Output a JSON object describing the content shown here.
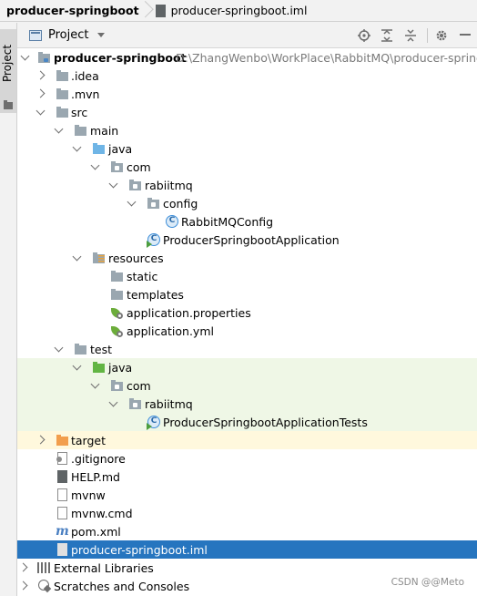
{
  "breadcrumb": {
    "root": "producer-springboot",
    "file": "producer-springboot.iml"
  },
  "stripe": {
    "label": "Project"
  },
  "tool_window": {
    "title": "Project",
    "buttons": [
      "locate-icon",
      "expand-all-icon",
      "collapse-all-icon",
      "gear-icon",
      "minimize-icon"
    ]
  },
  "tree": [
    {
      "name": "producer-springboot",
      "path": "D:\\ZhangWenbo\\WorkPlace\\RabbitMQ\\producer-springb",
      "icon": "module-folder-icon",
      "expanded": true
    },
    {
      "name": ".idea",
      "icon": "folder-icon",
      "expanded": false
    },
    {
      "name": ".mvn",
      "icon": "folder-icon",
      "expanded": false
    },
    {
      "name": "src",
      "icon": "folder-icon",
      "expanded": true
    },
    {
      "name": "main",
      "icon": "folder-icon",
      "expanded": true
    },
    {
      "name": "java",
      "icon": "source-root-folder-icon",
      "expanded": true
    },
    {
      "name": "com",
      "icon": "package-icon",
      "expanded": true
    },
    {
      "name": "rabiitmq",
      "icon": "package-icon",
      "expanded": true
    },
    {
      "name": "config",
      "icon": "package-icon",
      "expanded": true
    },
    {
      "name": "RabbitMQConfig",
      "icon": "class-icon"
    },
    {
      "name": "ProducerSpringbootApplication",
      "icon": "runnable-class-icon"
    },
    {
      "name": "resources",
      "icon": "resources-folder-icon",
      "expanded": true
    },
    {
      "name": "static",
      "icon": "folder-icon"
    },
    {
      "name": "templates",
      "icon": "folder-icon"
    },
    {
      "name": "application.properties",
      "icon": "spring-config-icon"
    },
    {
      "name": "application.yml",
      "icon": "spring-config-icon"
    },
    {
      "name": "test",
      "icon": "folder-icon",
      "expanded": true
    },
    {
      "name": "java",
      "icon": "test-root-folder-icon",
      "expanded": true
    },
    {
      "name": "com",
      "icon": "package-icon",
      "expanded": true
    },
    {
      "name": "rabiitmq",
      "icon": "package-icon",
      "expanded": true
    },
    {
      "name": "ProducerSpringbootApplicationTests",
      "icon": "runnable-class-icon"
    },
    {
      "name": "target",
      "icon": "excluded-folder-icon",
      "expanded": false
    },
    {
      "name": ".gitignore",
      "icon": "gitignore-file-icon"
    },
    {
      "name": "HELP.md",
      "icon": "markdown-file-icon"
    },
    {
      "name": "mvnw",
      "icon": "file-icon"
    },
    {
      "name": "mvnw.cmd",
      "icon": "file-icon"
    },
    {
      "name": "pom.xml",
      "icon": "maven-icon"
    },
    {
      "name": "producer-springboot.iml",
      "icon": "iml-file-icon",
      "selected": true
    },
    {
      "name": "External Libraries",
      "icon": "libraries-icon",
      "expanded": false
    },
    {
      "name": "Scratches and Consoles",
      "icon": "scratches-icon",
      "expanded": false
    }
  ],
  "watermark": "CSDN @@Meto",
  "colors": {
    "selection": "#2675bf",
    "test_row_bg": "#eff7e6",
    "source_folder": "#6fb5e6",
    "test_folder": "#62b543",
    "excluded_folder": "#f29e4c"
  }
}
